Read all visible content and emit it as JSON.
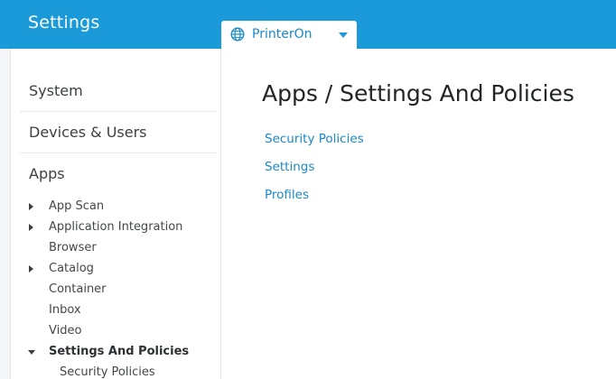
{
  "header": {
    "app_title": "Settings",
    "org_selector": {
      "label": "PrinterOn",
      "icon": "globe-icon"
    }
  },
  "sidebar": {
    "sections": [
      {
        "label": "System"
      },
      {
        "label": "Devices & Users"
      },
      {
        "label": "Apps"
      }
    ],
    "apps_items": [
      {
        "label": "App Scan",
        "expandable": true
      },
      {
        "label": "Application Integration",
        "expandable": true
      },
      {
        "label": "Browser",
        "expandable": false
      },
      {
        "label": "Catalog",
        "expandable": true
      },
      {
        "label": "Container",
        "expandable": false
      },
      {
        "label": "Inbox",
        "expandable": false
      },
      {
        "label": "Video",
        "expandable": false
      },
      {
        "label": "Settings And Policies",
        "expanded": true,
        "selected": true
      }
    ],
    "settings_children": [
      {
        "label": "Security Policies"
      }
    ]
  },
  "main": {
    "title": "Apps / Settings And Policies",
    "links": [
      {
        "label": "Security Policies"
      },
      {
        "label": "Settings"
      },
      {
        "label": "Profiles"
      }
    ]
  },
  "colors": {
    "header_bg": "#1a9ad8",
    "link": "#1a8ac8",
    "text": "#3c3f42"
  }
}
